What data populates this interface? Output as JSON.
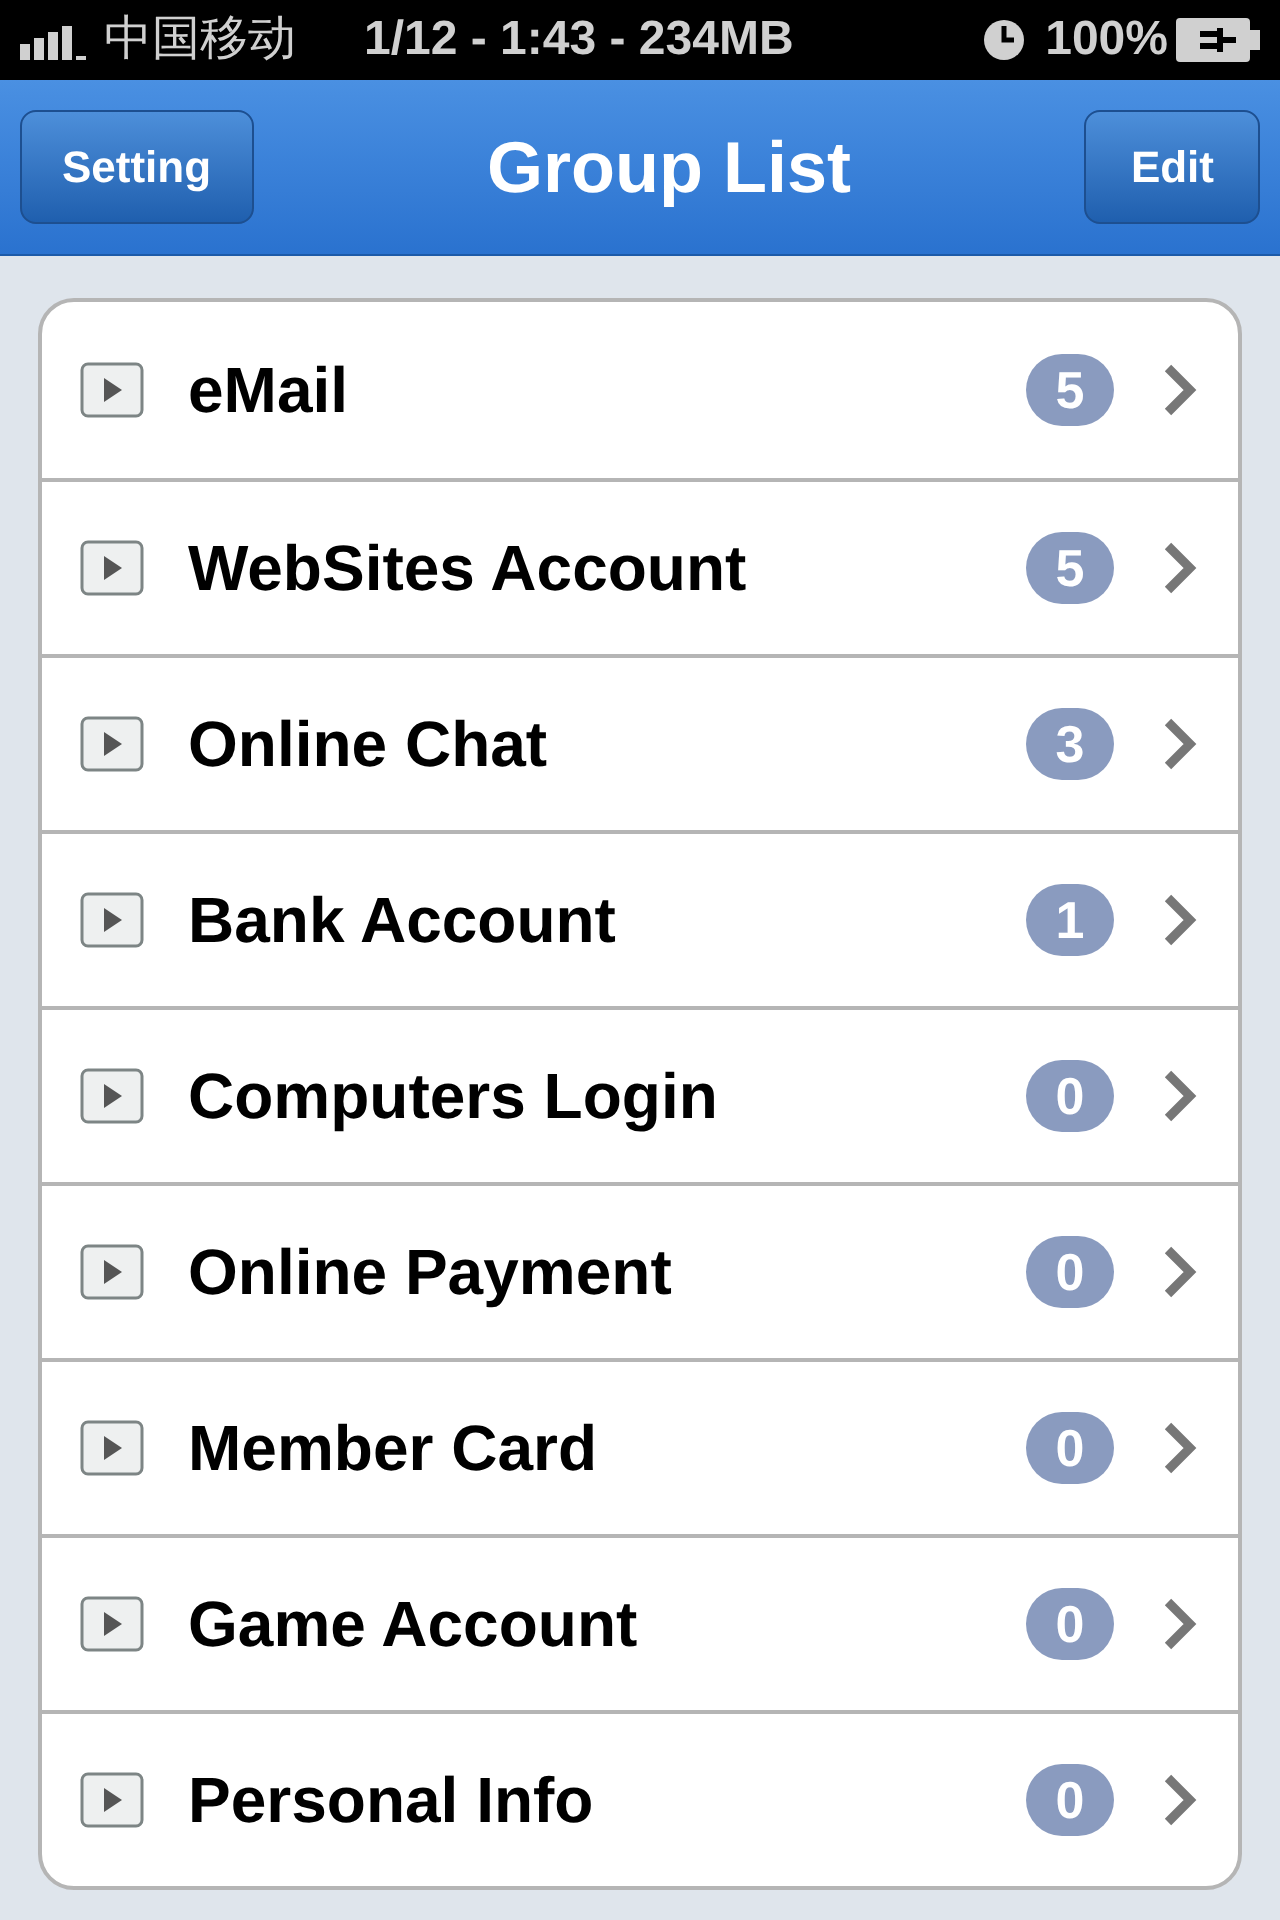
{
  "status_bar": {
    "carrier": "中国移动",
    "center": "1/12 - 1:43 - 234MB",
    "battery": "100%"
  },
  "nav_bar": {
    "left_button": "Setting",
    "title": "Group List",
    "right_button": "Edit"
  },
  "groups": [
    {
      "label": "eMail",
      "count": "5"
    },
    {
      "label": "WebSites Account",
      "count": "5"
    },
    {
      "label": "Online Chat",
      "count": "3"
    },
    {
      "label": "Bank Account",
      "count": "1"
    },
    {
      "label": "Computers Login",
      "count": "0"
    },
    {
      "label": "Online Payment",
      "count": "0"
    },
    {
      "label": "Member Card",
      "count": "0"
    },
    {
      "label": "Game Account",
      "count": "0"
    },
    {
      "label": "Personal Info",
      "count": "0"
    }
  ]
}
